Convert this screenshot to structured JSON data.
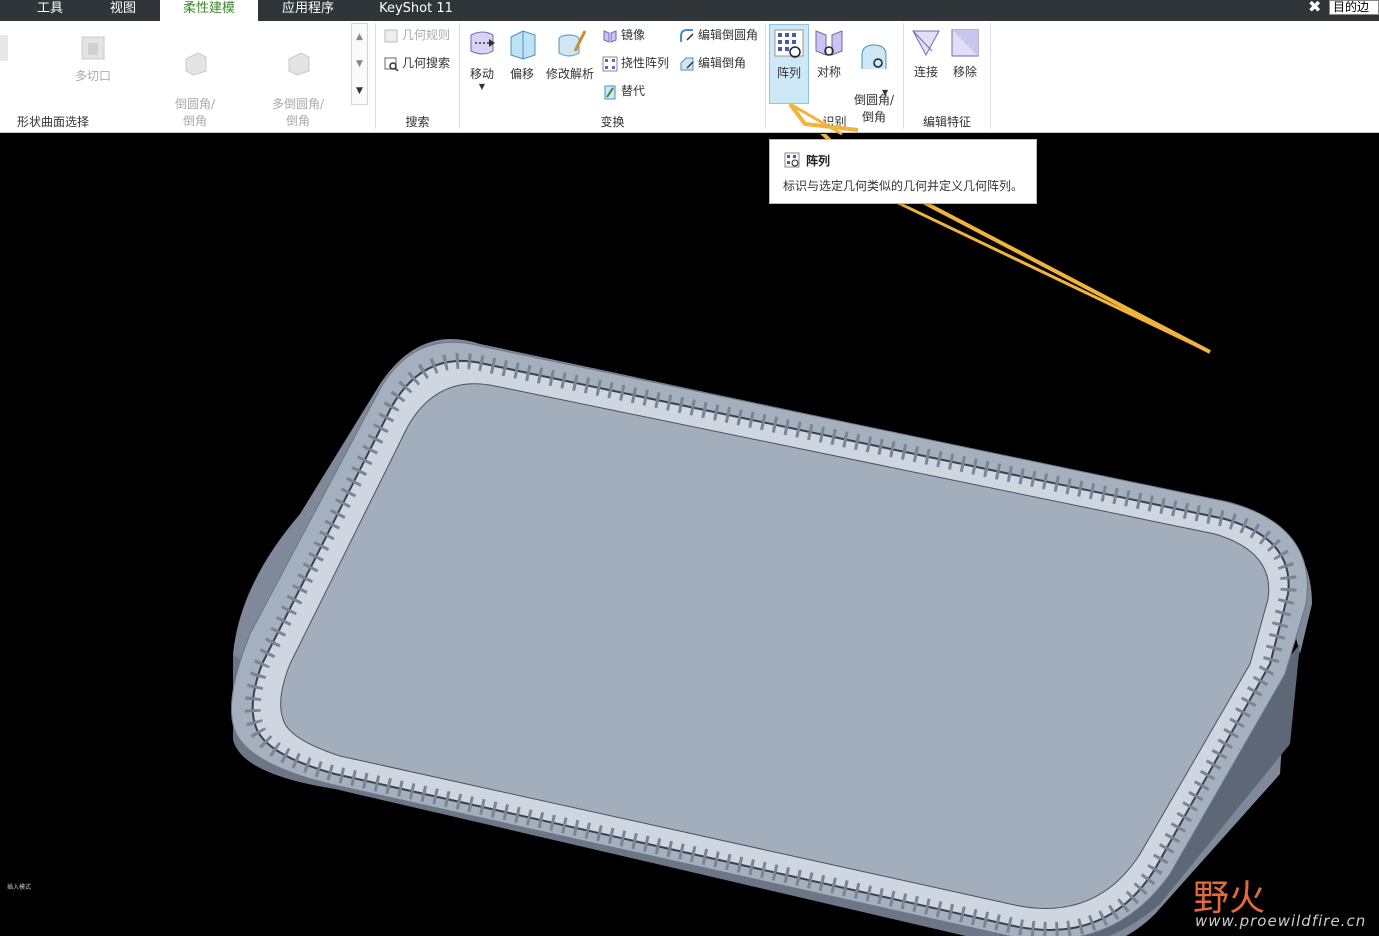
{
  "tabs": [
    {
      "label": "工具"
    },
    {
      "label": "视图"
    },
    {
      "label": "柔性建模"
    },
    {
      "label": "应用程序"
    },
    {
      "label": "KeyShot 11"
    }
  ],
  "goal_field": "目的边",
  "ribbon": {
    "shape_group": {
      "label": "形状曲面选择",
      "items": [
        "多切口",
        "倒圆角/\n倒角",
        "多倒圆角/\n倒角"
      ]
    },
    "search_group": {
      "label": "搜索",
      "rule": "几何规则",
      "search": "几何搜索"
    },
    "transform_group": {
      "label": "变换",
      "move": "移动",
      "offset": "偏移",
      "modify": "修改解析",
      "mirror": "镜像",
      "flex_array": "挠性阵列",
      "replace": "替代",
      "edit_round": "编辑倒圆角",
      "edit_chamfer": "编辑倒角"
    },
    "recognize_group": {
      "label": "识别",
      "array": "阵列",
      "symmetry": "对称",
      "round_chamfer": "倒圆角/\n倒角"
    },
    "edit_group": {
      "label": "编辑特征",
      "connect": "连接",
      "remove": "移除"
    }
  },
  "tooltip": {
    "title": "阵列",
    "description": "标识与选定几何类似的几何并定义几何阵列。"
  },
  "viewport": {
    "corner_text": "插入模式",
    "watermark_logo": "野火",
    "watermark_url": "www.proewildfire.cn"
  },
  "colors": {
    "tab_active_text": "#3a8a2c",
    "model_top": "#a3aebd",
    "arrow": "#f0b43a"
  }
}
